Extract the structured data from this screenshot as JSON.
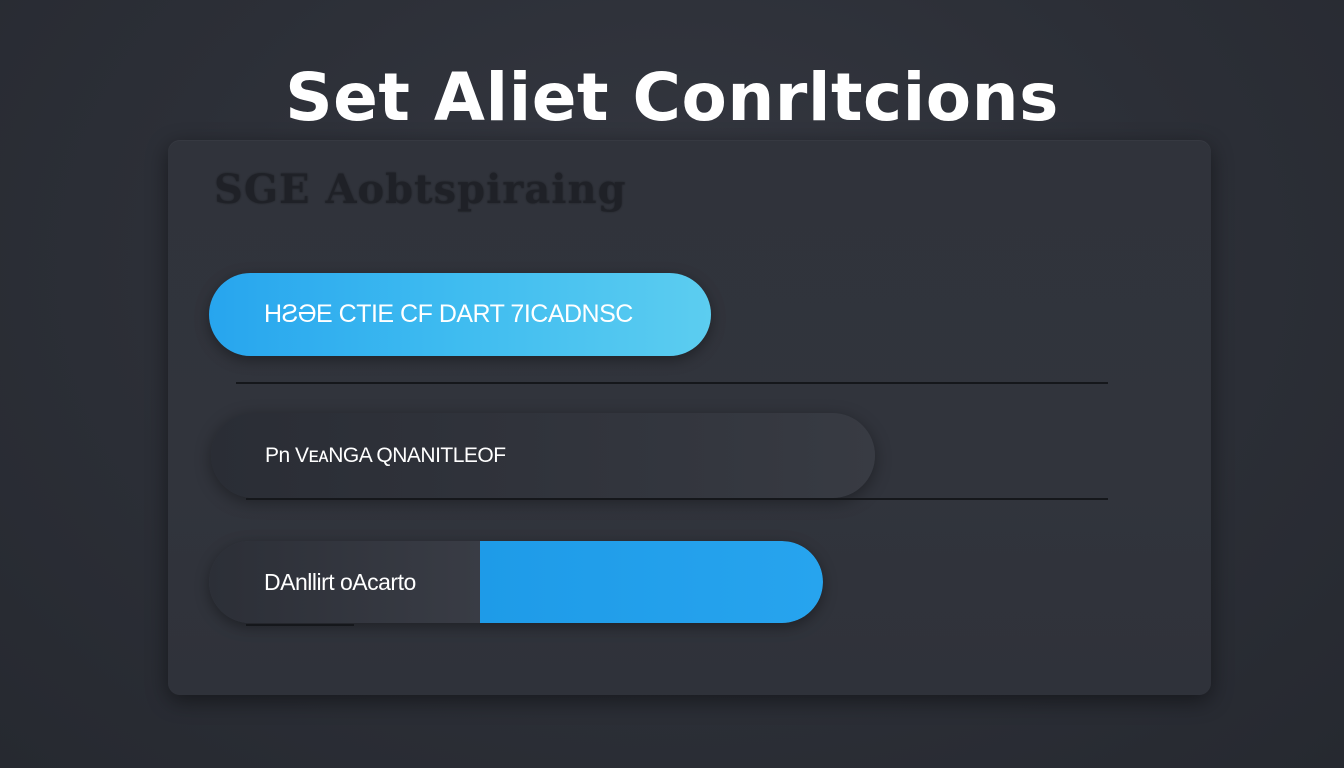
{
  "page": {
    "title": "Set Aliet Conrltcions"
  },
  "panel": {
    "heading": "SGE Aobtspiraing",
    "primary_button_label": "HƧƏE CTIE CF DART 7ICADNSC",
    "secondary_field_label": "Pn VᴇᴀNGA QNANITLEOF",
    "toggle_left_label": "DAnllirt oAcarto",
    "toggle_state": "on"
  },
  "colors": {
    "background": "#2c2f37",
    "panel": "#31343c",
    "accent_blue": "#27a5ee",
    "accent_cyan": "#5ccdf0",
    "divider": "#15171b",
    "text": "#ffffff"
  }
}
